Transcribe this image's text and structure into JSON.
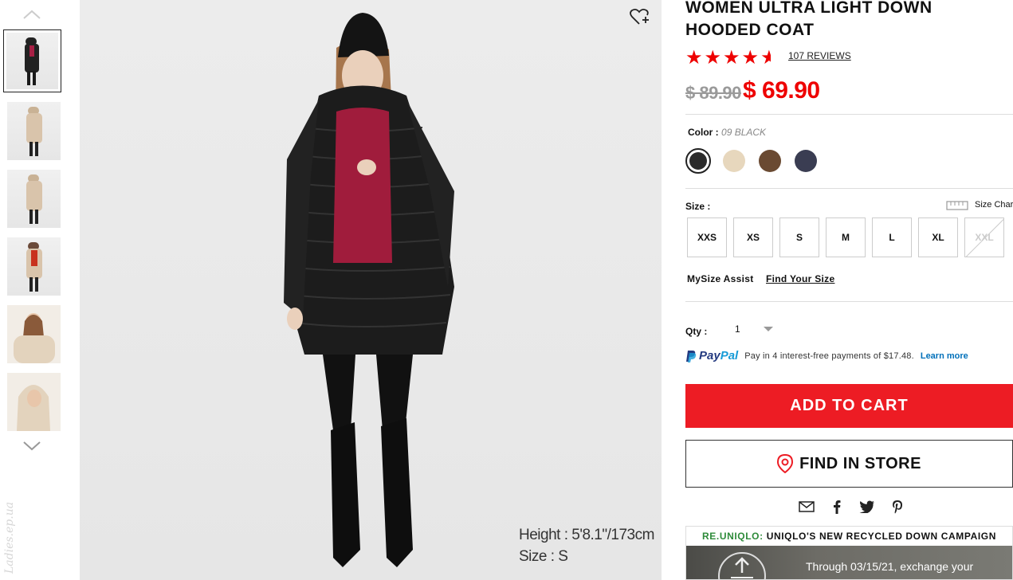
{
  "gallery": {
    "thumbnails": [
      {
        "label": "thumb-1",
        "color": "#1a1a1a"
      },
      {
        "label": "thumb-2",
        "color": "#d9c4ab"
      },
      {
        "label": "thumb-3",
        "color": "#d9c4ab"
      },
      {
        "label": "thumb-4",
        "color": "#1a1a1a"
      },
      {
        "label": "thumb-5",
        "color": "#e3d3bd"
      },
      {
        "label": "thumb-6",
        "color": "#e3d3bd"
      }
    ],
    "watermark": "Ladies.ep.ua"
  },
  "main_image": {
    "model_height": "Height : 5'8.1\"/173cm",
    "model_size": "Size : S"
  },
  "product": {
    "title_line1": "WOMEN ULTRA LIGHT DOWN",
    "title_line2": "HOODED COAT",
    "rating": 4.5,
    "reviews": "107 REVIEWS",
    "price_old": "$ 89.90",
    "price_new": "$ 69.90",
    "color_label": "Color :",
    "color_value": "09 BLACK",
    "swatches": [
      "#2b2b2b",
      "#e7d7bd",
      "#6a4a32",
      "#3a3d52"
    ],
    "size_label": "Size :",
    "size_chart": "Size Chart",
    "sizes": [
      "XXS",
      "XS",
      "S",
      "M",
      "L",
      "XL",
      "XXL"
    ],
    "mysize_label": "MySize Assist",
    "find_size": "Find Your Size",
    "qty_label": "Qty :",
    "qty_value": "1",
    "paypal_brand_a": "Pay",
    "paypal_brand_b": "Pal",
    "paypal_text": "Pay in 4 interest-free payments of $17.48.",
    "paypal_learn": "Learn more",
    "add_to_cart": "ADD TO CART",
    "find_in_store": "FIND IN STORE"
  },
  "campaign": {
    "brand": "RE.UNIQLO:",
    "title": "UNIQLO'S NEW RECYCLED DOWN CAMPAIGN",
    "text": "Through 03/15/21, exchange your"
  },
  "colors": {
    "accent_red": "#ed1c24",
    "star_red": "#e00000",
    "campaign_green": "#2e8b3a"
  }
}
